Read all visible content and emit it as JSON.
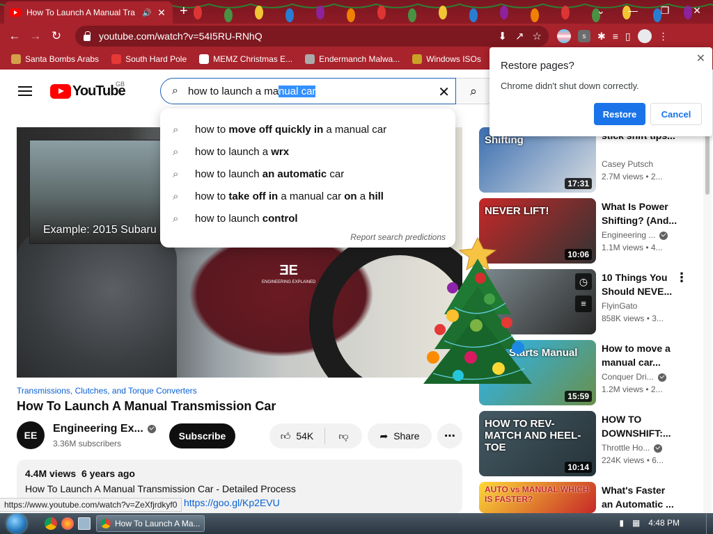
{
  "browser": {
    "tab": {
      "title": "How To Launch A Manual Tra",
      "audio_icon": "audio-icon",
      "close": "✕"
    },
    "new_tab": "+",
    "window_controls": {
      "chevron": "⌄",
      "minimize": "—",
      "restore": "❐",
      "close": "✕"
    },
    "url": "youtube.com/watch?v=54I5RU-RNhQ",
    "bookmarks": [
      {
        "label": "Santa Bombs Arabs",
        "color": "#d4a04a"
      },
      {
        "label": "South Hard Pole",
        "color": "#e53935"
      },
      {
        "label": "MEMZ Christmas E...",
        "color": "#ffffff"
      },
      {
        "label": "Endermanch Malwa...",
        "color": "#aaaaaa"
      },
      {
        "label": "Windows ISOs",
        "color": "#c9a227"
      }
    ]
  },
  "youtube": {
    "logo_text": "YouTube",
    "region": "GB",
    "search_query_plain": "how to launch a ma",
    "search_query_selected": "nual car",
    "suggestions": [
      {
        "parts": [
          "how to ",
          "move off quickly in",
          " a manual car"
        ]
      },
      {
        "parts": [
          "how to launch a ",
          "wrx",
          ""
        ]
      },
      {
        "parts": [
          "how to launch ",
          "an automatic",
          " car"
        ]
      },
      {
        "parts": [
          "how to ",
          "take off in",
          " a manual car ",
          "on",
          " a ",
          "hill"
        ]
      },
      {
        "parts": [
          "how to launch ",
          "control",
          ""
        ]
      }
    ],
    "report_predictions": "Report search predictions"
  },
  "video": {
    "caption": "Example: 2015 Subaru",
    "shirt_logo": "ENGINEERING EXPLAINED",
    "tags": "Transmissions, Clutches, and Torque Converters",
    "title": "How To Launch A Manual Transmission Car",
    "channel": "Engineering Ex...",
    "channel_avatar": "EE",
    "subscribers": "3.36M subscribers",
    "subscribe": "Subscribe",
    "likes": "54K",
    "share": "Share",
    "views": "4.4M views",
    "age": "6 years ago",
    "desc_line": "How To Launch A Manual Transmission Car - Detailed Process",
    "desc_link": "https://goo.gl/Kp2EVU"
  },
  "status_url": "https://www.youtube.com/watch?v=ZeXfjrdkyf0",
  "sidebar": [
    {
      "title": "stick shift tips...",
      "channel": "Casey Putsch",
      "meta": "2.7M views • 2...",
      "duration": "17:31",
      "thumb_text": "Shifting",
      "verified": false,
      "colors": [
        "#3b6fb0",
        "#d9dde2"
      ]
    },
    {
      "title": "What Is Power Shifting? (And...",
      "channel": "Engineering ...",
      "meta": "1.1M views • 4...",
      "duration": "10:06",
      "thumb_text": "NEVER LIFT!",
      "verified": true,
      "colors": [
        "#c62828",
        "#333333"
      ]
    },
    {
      "title": "10 Things You Should NEVE...",
      "channel": "FlyinGato",
      "meta": "858K views • 3...",
      "duration": "",
      "thumb_text": "",
      "verified": false,
      "colors": [
        "#7d8a8e",
        "#2a2a2a"
      ]
    },
    {
      "title": "How to move a manual car...",
      "channel": "Conquer Dri...",
      "meta": "1.2M views • 2...",
      "duration": "15:59",
      "thumb_text": "Fast Starts Manual Car",
      "verified": true,
      "colors": [
        "#29b6f6",
        "#6a8f4a"
      ]
    },
    {
      "title": "HOW TO DOWNSHIFT:...",
      "channel": "Throttle Ho...",
      "meta": "224K views • 6...",
      "duration": "10:14",
      "thumb_text": "HOW TO REV-MATCH AND HEEL-TOE",
      "verified": true,
      "colors": [
        "#455a64",
        "#263238"
      ]
    },
    {
      "title": "What's Faster an Automatic ...",
      "channel": "",
      "meta": "",
      "duration": "",
      "thumb_text": "AUTO vs MANUAL WHICH IS FASTER?",
      "verified": false,
      "colors": [
        "#fdd835",
        "#c62828"
      ]
    }
  ],
  "restore_dialog": {
    "title": "Restore pages?",
    "message": "Chrome didn't shut down correctly.",
    "restore": "Restore",
    "cancel": "Cancel"
  },
  "taskbar": {
    "task_label": "How To Launch A Ma...",
    "time": "4:48 PM"
  }
}
